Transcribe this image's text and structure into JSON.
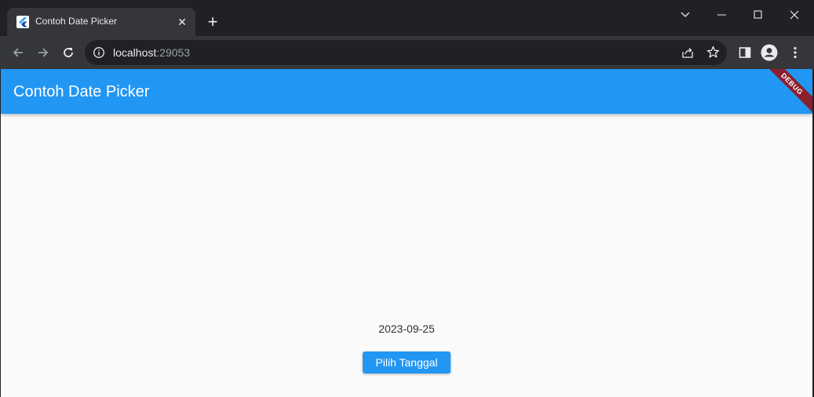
{
  "browser": {
    "tab": {
      "title": "Contoh Date Picker",
      "close_glyph": "✕",
      "favicon": "flutter-logo-icon"
    },
    "new_tab_glyph": "+",
    "address": {
      "host": "localhost",
      "port": ":29053"
    },
    "icons": [
      "back-icon",
      "forward-icon",
      "reload-icon",
      "site-info-icon",
      "share-icon",
      "bookmark-star-icon",
      "side-panel-icon",
      "profile-icon",
      "menu-icon"
    ]
  },
  "app": {
    "title": "Contoh Date Picker",
    "debug_banner": "DEBUG",
    "selected_date": "2023-09-25",
    "pick_button_label": "Pilih Tanggal"
  },
  "colors": {
    "primary": "#2196f3",
    "background": "#fafafa",
    "browser_frame": "#202124",
    "toolbar": "#35363a"
  }
}
